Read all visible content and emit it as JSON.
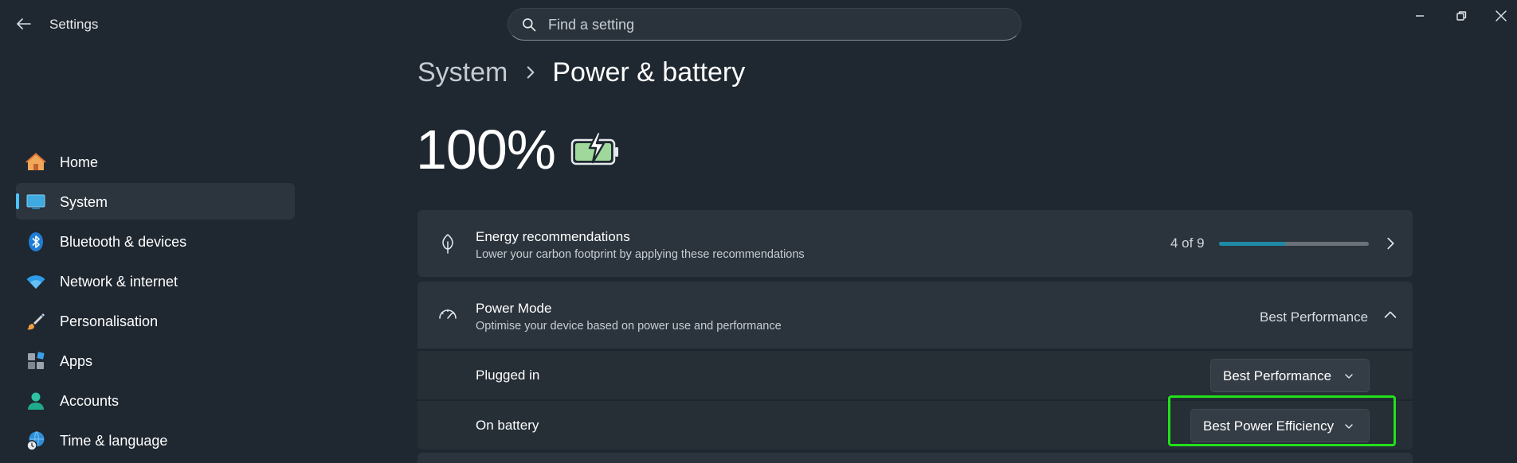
{
  "window": {
    "title": "Settings",
    "icons": {
      "back": "back-arrow-icon",
      "minimize": "minimize-icon",
      "restore": "restore-icon",
      "close": "close-icon"
    }
  },
  "search": {
    "placeholder": "Find a setting",
    "value": "",
    "icon": "search-icon"
  },
  "sidebar": {
    "items": [
      {
        "label": "Home",
        "icon": "home-icon",
        "active": false
      },
      {
        "label": "System",
        "icon": "system-monitor-icon",
        "active": true
      },
      {
        "label": "Bluetooth & devices",
        "icon": "bluetooth-icon",
        "active": false
      },
      {
        "label": "Network & internet",
        "icon": "wifi-icon",
        "active": false
      },
      {
        "label": "Personalisation",
        "icon": "paint-brush-icon",
        "active": false
      },
      {
        "label": "Apps",
        "icon": "apps-icon",
        "active": false
      },
      {
        "label": "Accounts",
        "icon": "account-icon",
        "active": false
      },
      {
        "label": "Time & language",
        "icon": "globe-clock-icon",
        "active": false
      }
    ]
  },
  "breadcrumb": {
    "parent": "System",
    "current": "Power & battery"
  },
  "battery": {
    "percent_text": "100%",
    "level": 1.0,
    "charging": true,
    "icon": "battery-charging-icon"
  },
  "energy": {
    "title": "Energy recommendations",
    "subtitle": "Lower your carbon footprint by applying these recommendations",
    "progress_text": "4 of 9",
    "progress": {
      "done": 4,
      "total": 9
    },
    "icon": "leaf-icon"
  },
  "power_mode": {
    "title": "Power Mode",
    "subtitle": "Optimise your device based on power use and performance",
    "value": "Best Performance",
    "expanded": true,
    "icon": "gauge-icon",
    "plugged_in": {
      "label": "Plugged in",
      "value": "Best Performance"
    },
    "on_battery": {
      "label": "On battery",
      "value": "Best Power Efficiency"
    }
  },
  "colors": {
    "background": "#1f2730",
    "card": "#2b333c",
    "accent": "#4cc2ff",
    "progress": "#1f8aa6",
    "highlight": "#22e01c"
  }
}
